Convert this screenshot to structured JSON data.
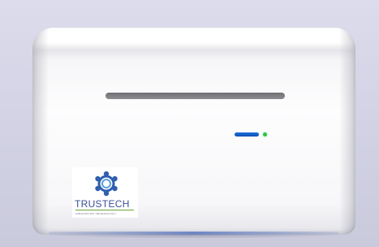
{
  "logo": {
    "brand": "TRUSTECH",
    "tagline": "INNOVATION TECHNOLOGY"
  },
  "colors": {
    "background": "#d4d4e6",
    "device_body": "#ffffff",
    "slot": "#7a7a80",
    "indicator_led": "#1763c9",
    "status_dot": "#35c04a",
    "logo_text": "#3a4f9a",
    "logo_accent": "#6aa43a"
  },
  "indicators": {
    "led_bar": "blue-led-bar",
    "status_dot": "green-status-dot"
  },
  "icons": {
    "logo_mark": "gear-ring-icon"
  }
}
